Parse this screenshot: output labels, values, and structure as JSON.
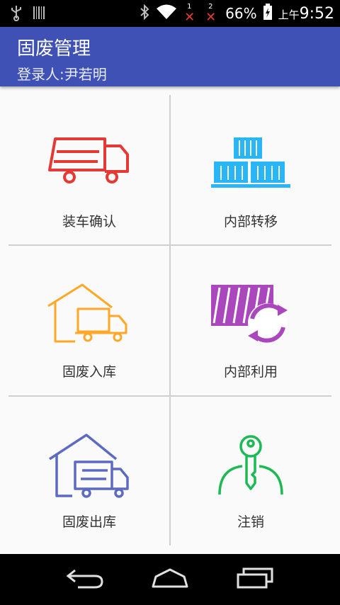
{
  "status_bar": {
    "usb_icon": "usb-icon",
    "barcode_icon": "barcode-icon",
    "bluetooth_icon": "bluetooth-icon",
    "wifi_icon": "wifi-icon",
    "sim1_label": "1",
    "sim2_label": "2",
    "battery_percent": "66%",
    "time_prefix": "上午",
    "time": "9:52"
  },
  "header": {
    "title": "固废管理",
    "subtitle": "登录人:尹若明",
    "color": "#3f51b5"
  },
  "menu": {
    "items": [
      {
        "label": "装车确认",
        "icon": "truck-icon",
        "color": "#e53935"
      },
      {
        "label": "内部转移",
        "icon": "boxes-icon",
        "color": "#29b6f6"
      },
      {
        "label": "固废入库",
        "icon": "warehouse-truck-icon",
        "color": "#ffa726"
      },
      {
        "label": "内部利用",
        "icon": "recycle-icon",
        "color": "#ab47bc"
      },
      {
        "label": "固废出库",
        "icon": "warehouse-truck-icon",
        "color": "#5c6bc0"
      },
      {
        "label": "注销",
        "icon": "logout-user-key-icon",
        "color": "#1db954"
      }
    ]
  },
  "nav": {
    "back_icon": "back-icon",
    "home_icon": "home-icon",
    "recents_icon": "recents-icon"
  }
}
